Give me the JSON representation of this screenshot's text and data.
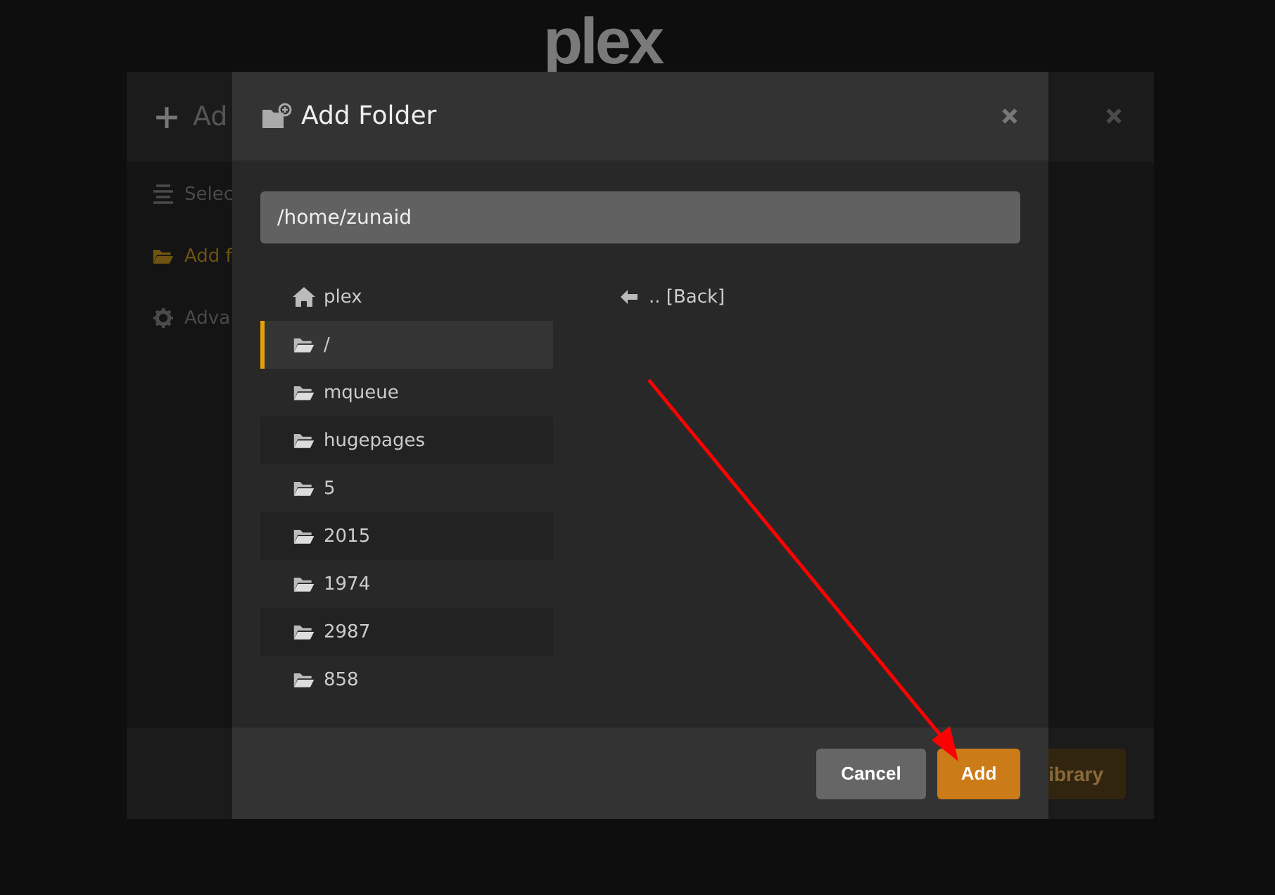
{
  "logo": {
    "text": "plex"
  },
  "background_dialog": {
    "title": "Ad",
    "sidebar": [
      {
        "label": "Selec",
        "kind": "list",
        "selected": false
      },
      {
        "label": "Add f",
        "kind": "folder",
        "selected": true
      },
      {
        "label": "Adva",
        "kind": "gear",
        "selected": false
      }
    ],
    "button": "ibrary"
  },
  "dialog": {
    "title": "Add Folder",
    "path": "/home/zunaid",
    "places": [
      {
        "label": "plex",
        "kind": "home",
        "selected": false
      },
      {
        "label": "/",
        "kind": "folder",
        "selected": true
      },
      {
        "label": "mqueue",
        "kind": "folder",
        "selected": false
      },
      {
        "label": "hugepages",
        "kind": "folder",
        "selected": false
      },
      {
        "label": "5",
        "kind": "folder",
        "selected": false
      },
      {
        "label": "2015",
        "kind": "folder",
        "selected": false
      },
      {
        "label": "1974",
        "kind": "folder",
        "selected": false
      },
      {
        "label": "2987",
        "kind": "folder",
        "selected": false
      },
      {
        "label": "858",
        "kind": "folder",
        "selected": false
      }
    ],
    "back": ".. [Back]",
    "buttons": [
      {
        "label": "Cancel",
        "kind": "secondary"
      },
      {
        "label": "Add",
        "kind": "primary"
      }
    ]
  }
}
